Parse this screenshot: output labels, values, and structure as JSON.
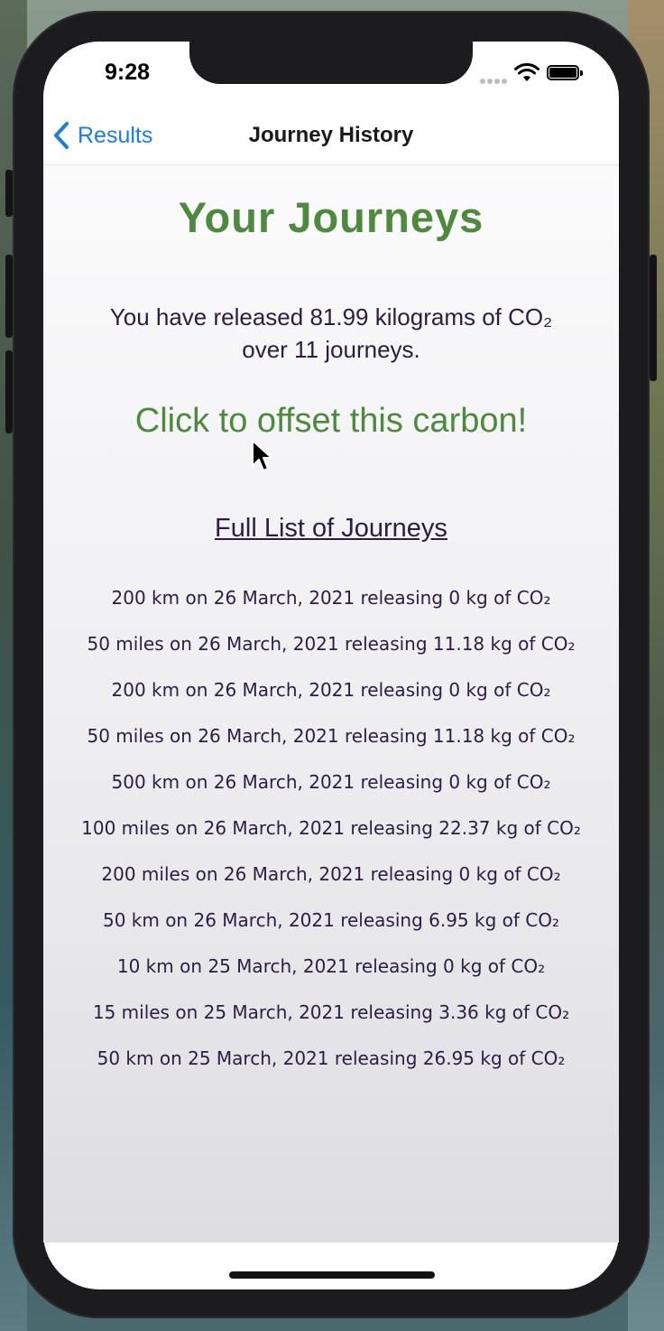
{
  "status_bar": {
    "time": "9:28"
  },
  "nav": {
    "back_label": "Results",
    "title": "Journey History"
  },
  "main": {
    "heading": "Your Journeys",
    "summary_line1": "You have released 81.99 kilograms of CO₂",
    "summary_line2": "over 11 journeys.",
    "offset_button": "Click to offset this carbon!",
    "list_title": "Full List of Journeys"
  },
  "journeys": [
    "200 km on 26 March, 2021 releasing 0 kg of CO₂",
    "50 miles on 26 March, 2021 releasing 11.18 kg of CO₂",
    "200 km on 26 March, 2021 releasing 0 kg of CO₂",
    "50 miles on 26 March, 2021 releasing 11.18 kg of CO₂",
    "500 km on 26 March, 2021 releasing 0 kg of CO₂",
    "100 miles on 26 March, 2021 releasing 22.37 kg of CO₂",
    "200 miles on 26 March, 2021 releasing 0 kg of CO₂",
    "50 km on 26 March, 2021 releasing 6.95 kg of CO₂",
    "10 km on 25 March, 2021 releasing 0 kg of CO₂",
    "15 miles on 25 March, 2021 releasing 3.36 kg of CO₂",
    "50 km on 25 March, 2021 releasing 26.95 kg of CO₂"
  ],
  "colors": {
    "accent_green": "#4d8a3d",
    "text_purple": "#2c1d43",
    "link_blue": "#1a7ee0"
  }
}
